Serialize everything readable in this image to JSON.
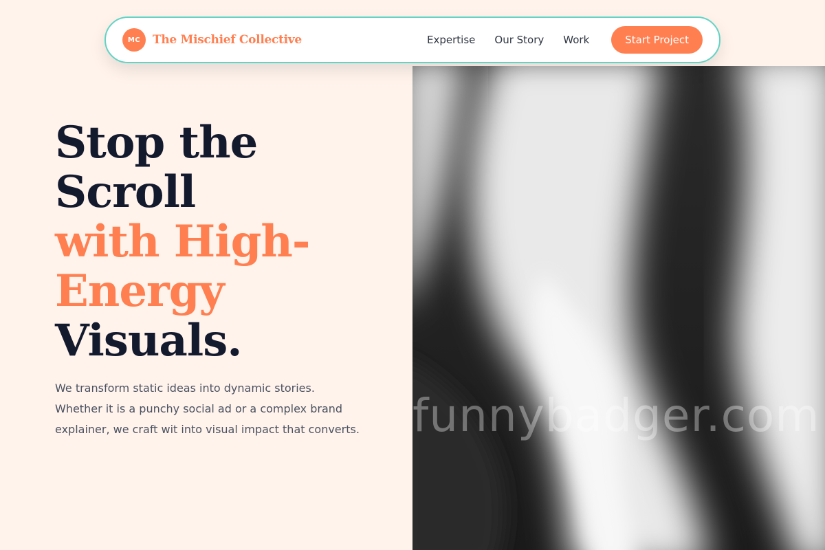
{
  "brand": {
    "badge": "MC",
    "name": "The Mischief Collective"
  },
  "nav": {
    "links": [
      "Expertise",
      "Our Story",
      "Work"
    ],
    "cta": "Start Project"
  },
  "hero": {
    "headline_dark_1": "Stop the",
    "headline_dark_2": "Scroll",
    "headline_accent_1": "with High-",
    "headline_accent_2": "Energy",
    "headline_dark_3": "Visuals.",
    "subtext": "We transform static ideas into dynamic stories. Whether it is a punchy social ad or a complex brand explainer, we craft wit into visual impact that converts.",
    "image_watermark": "funnybadger.com"
  },
  "colors": {
    "accent": "#ff7f50",
    "navy": "#141a2e",
    "teal_border": "#62d3c4",
    "background": "#fff3ec"
  }
}
